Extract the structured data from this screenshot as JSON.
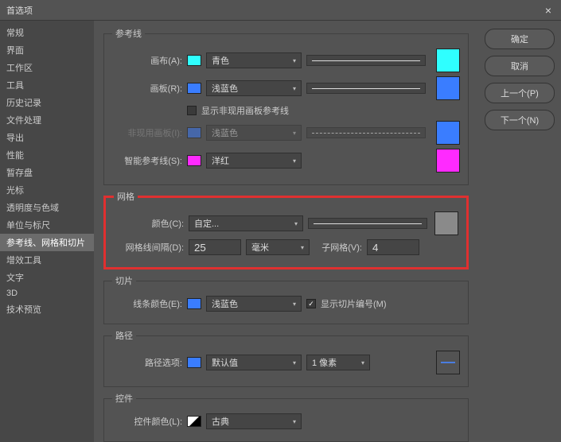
{
  "titlebar": {
    "title": "首选项"
  },
  "sidebar": {
    "items": [
      {
        "label": "常规"
      },
      {
        "label": "界面"
      },
      {
        "label": "工作区"
      },
      {
        "label": "工具"
      },
      {
        "label": "历史记录"
      },
      {
        "label": "文件处理"
      },
      {
        "label": "导出"
      },
      {
        "label": "性能"
      },
      {
        "label": "暂存盘"
      },
      {
        "label": "光标"
      },
      {
        "label": "透明度与色域"
      },
      {
        "label": "单位与标尺"
      },
      {
        "label": "参考线、网格和切片"
      },
      {
        "label": "增效工具"
      },
      {
        "label": "文字"
      },
      {
        "label": "3D"
      },
      {
        "label": "技术预览"
      }
    ],
    "selected_index": 12
  },
  "buttons": {
    "ok": "确定",
    "cancel": "取消",
    "prev": "上一个(P)",
    "next": "下一个(N)"
  },
  "guides": {
    "legend": "参考线",
    "canvas_label": "画布(A):",
    "canvas_color": "青色",
    "canvas_swatch": "#2fffff",
    "artboard_label": "画板(R):",
    "artboard_color": "浅蓝色",
    "artboard_swatch": "#3a7dff",
    "show_inactive_label": "显示非现用画板参考线",
    "inactive_label": "非现用画板(I):",
    "inactive_color": "浅蓝色",
    "inactive_swatch": "#3a7dff",
    "smart_label": "智能参考线(S):",
    "smart_color": "洋红",
    "smart_swatch": "#ff2aff"
  },
  "grid": {
    "legend": "网格",
    "color_label": "颜色(C):",
    "color_value": "自定...",
    "swatch": "#8a8a8a",
    "spacing_label": "网格线间隔(D):",
    "spacing_value": "25",
    "spacing_unit": "毫米",
    "subdiv_label": "子网格(V):",
    "subdiv_value": "4"
  },
  "slices": {
    "legend": "切片",
    "color_label": "线条颜色(E):",
    "color_value": "浅蓝色",
    "swatch": "#3a7dff",
    "show_numbers_label": "显示切片编号(M)"
  },
  "path": {
    "legend": "路径",
    "options_label": "路径选项:",
    "options_color": "默认值",
    "options_swatch": "#3a7dff",
    "thickness": "1 像素",
    "preview_swatch": "#325aa8"
  },
  "controls": {
    "legend": "控件",
    "color_label": "控件颜色(L):",
    "color_value": "古典"
  }
}
